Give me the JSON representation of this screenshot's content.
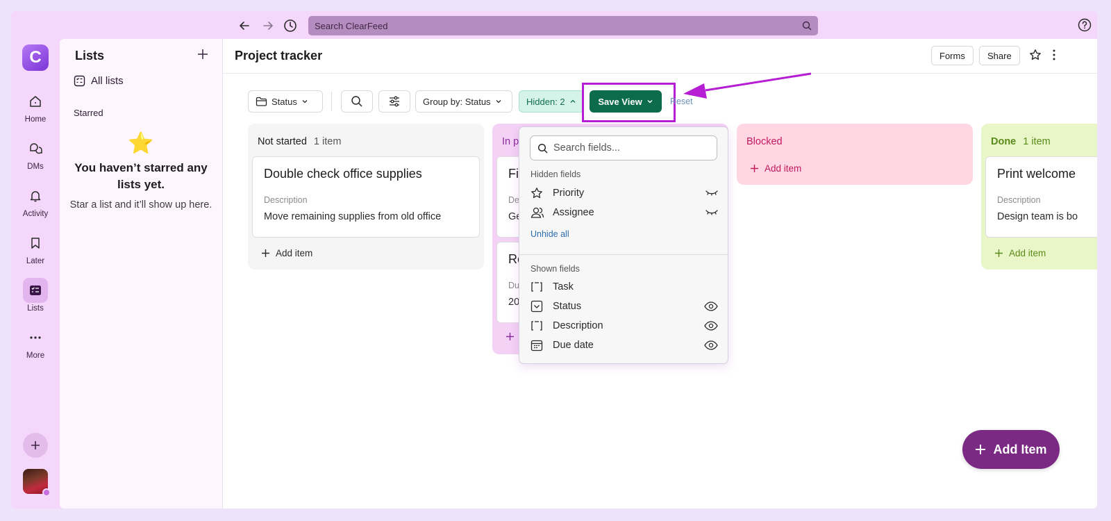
{
  "topbar": {
    "search_placeholder": "Search ClearFeed",
    "icons": [
      "arrow-left-icon",
      "arrow-right-icon",
      "history-icon",
      "search-icon",
      "help-icon"
    ]
  },
  "rail": {
    "logo_letter": "C",
    "items": [
      {
        "label": "Home",
        "icon": "home-icon"
      },
      {
        "label": "DMs",
        "icon": "dms-icon"
      },
      {
        "label": "Activity",
        "icon": "bell-icon"
      },
      {
        "label": "Later",
        "icon": "bookmark-icon"
      },
      {
        "label": "Lists",
        "icon": "lists-icon",
        "active": true
      },
      {
        "label": "More",
        "icon": "more-icon"
      }
    ]
  },
  "sidebar": {
    "title": "Lists",
    "all_lists": "All lists",
    "starred_label": "Starred",
    "empty_star": "⭐",
    "empty_heading": "You haven’t starred any lists yet.",
    "empty_text": "Star a list and it’ll show up here."
  },
  "header": {
    "title": "Project tracker",
    "forms_label": "Forms",
    "share_label": "Share"
  },
  "toolbar": {
    "status_label": "Status",
    "group_by_label": "Group by: Status",
    "hidden_label": "Hidden: 2",
    "save_view_label": "Save View",
    "reset_label": "Reset"
  },
  "columns": [
    {
      "name": "Not started",
      "count": "1 item",
      "color": "#f5f5f5",
      "name_color": "#2a2a2a",
      "card": {
        "title": "Double check office supplies",
        "field_label": "Description",
        "field_value": "Move remaining supplies from old office"
      },
      "add_label": "Add item"
    },
    {
      "name": "In p",
      "color": "#f4d2f6",
      "name_color": "#8a2a9a",
      "cards": [
        {
          "title": "Fi",
          "field_label": "De",
          "field_value": "Ge"
        },
        {
          "title": "Re",
          "field_label": "Du",
          "field_value": "20"
        }
      ]
    },
    {
      "name": "Blocked",
      "color": "#ffd7e3",
      "name_color": "#c2185b",
      "add_label": "Add item"
    },
    {
      "name": "Done",
      "count": "1 item",
      "color": "#e8f6c8",
      "name_color": "#5a8a1a",
      "card": {
        "title": "Print welcome",
        "field_label": "Description",
        "field_value": "Design team is bo"
      },
      "add_label": "Add item"
    }
  ],
  "popover": {
    "search_placeholder": "Search fields...",
    "hidden_heading": "Hidden fields",
    "hidden_fields": [
      {
        "name": "Priority",
        "icon": "star-outline-icon",
        "state_icon": "eye-closed-icon"
      },
      {
        "name": "Assignee",
        "icon": "users-icon",
        "state_icon": "eye-closed-icon"
      }
    ],
    "unhide_all": "Unhide all",
    "shown_heading": "Shown fields",
    "shown_fields": [
      {
        "name": "Task",
        "icon": "text-field-icon",
        "state_icon": ""
      },
      {
        "name": "Status",
        "icon": "select-field-icon",
        "state_icon": "eye-icon"
      },
      {
        "name": "Description",
        "icon": "text-field-icon",
        "state_icon": "eye-icon"
      },
      {
        "name": "Due date",
        "icon": "calendar-icon",
        "state_icon": "eye-icon"
      }
    ]
  },
  "fab_label": "Add Item",
  "colors": {
    "accent": "#b51ed2",
    "save_green": "#0b6b4a",
    "fab_purple": "#7a2a82"
  }
}
